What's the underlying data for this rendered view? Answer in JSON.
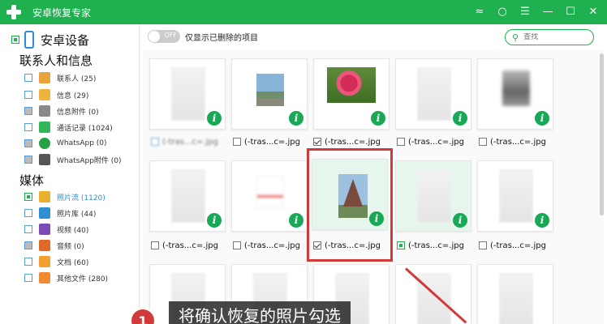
{
  "app": {
    "title": "安卓恢复专家"
  },
  "titlebar_icons": [
    "wifi-icon",
    "chat-icon",
    "menu-icon",
    "minimize-icon",
    "maximize-icon",
    "close-icon"
  ],
  "sidebar": {
    "device_label": "安卓设备",
    "groups": [
      {
        "title": "联系人和信息",
        "items": [
          {
            "label": "联系人 (25)",
            "icon": "contacts-icon",
            "color": "#e8a33a"
          },
          {
            "label": "信息 (29)",
            "icon": "messages-icon",
            "color": "#f0b43c"
          },
          {
            "label": "信息附件 (0)",
            "icon": "attachment-icon",
            "color": "#8a8a8a"
          },
          {
            "label": "通话记录 (1024)",
            "icon": "call-log-icon",
            "color": "#33b65a"
          },
          {
            "label": "WhatsApp (0)",
            "icon": "whatsapp-icon",
            "color": "#25a244"
          },
          {
            "label": "WhatsApp附件 (0)",
            "icon": "whatsapp-attachment-icon",
            "color": "#555555"
          }
        ]
      },
      {
        "title": "媒体",
        "items": [
          {
            "label": "照片流 (1120)",
            "icon": "photo-stream-icon",
            "color": "#e9b030"
          },
          {
            "label": "照片库 (44)",
            "icon": "photo-library-icon",
            "color": "#2f8fd0"
          },
          {
            "label": "视频 (40)",
            "icon": "video-icon",
            "color": "#7b4bb6"
          },
          {
            "label": "音频 (0)",
            "icon": "audio-icon",
            "color": "#e06a2a"
          },
          {
            "label": "文档 (60)",
            "icon": "documents-icon",
            "color": "#f0a030"
          },
          {
            "label": "其他文件 (280)",
            "icon": "other-files-icon",
            "color": "#f08a30"
          }
        ]
      }
    ]
  },
  "toolbar": {
    "toggle_state": "OFF",
    "toggle_label": "仅显示已删除的项目",
    "search_placeholder": "查找"
  },
  "grid": {
    "row1": [
      "(-tras...c=.jpg",
      "(-tras...c=.jpg",
      "(-tras...c=.jpg",
      "(-tras...c=.jpg"
    ],
    "row1_first_blurred": "(-tras...c=.jpg",
    "row2": [
      "(-tras...c=.jpg",
      "(-tras...c=.jpg",
      "(-tras...c=.jpg",
      "(-tras...c=.jpg",
      "(-tras...c=.jpg"
    ],
    "info_symbol": "i"
  },
  "annotation": {
    "step": "1",
    "caption": "将确认恢复的照片勾选"
  }
}
